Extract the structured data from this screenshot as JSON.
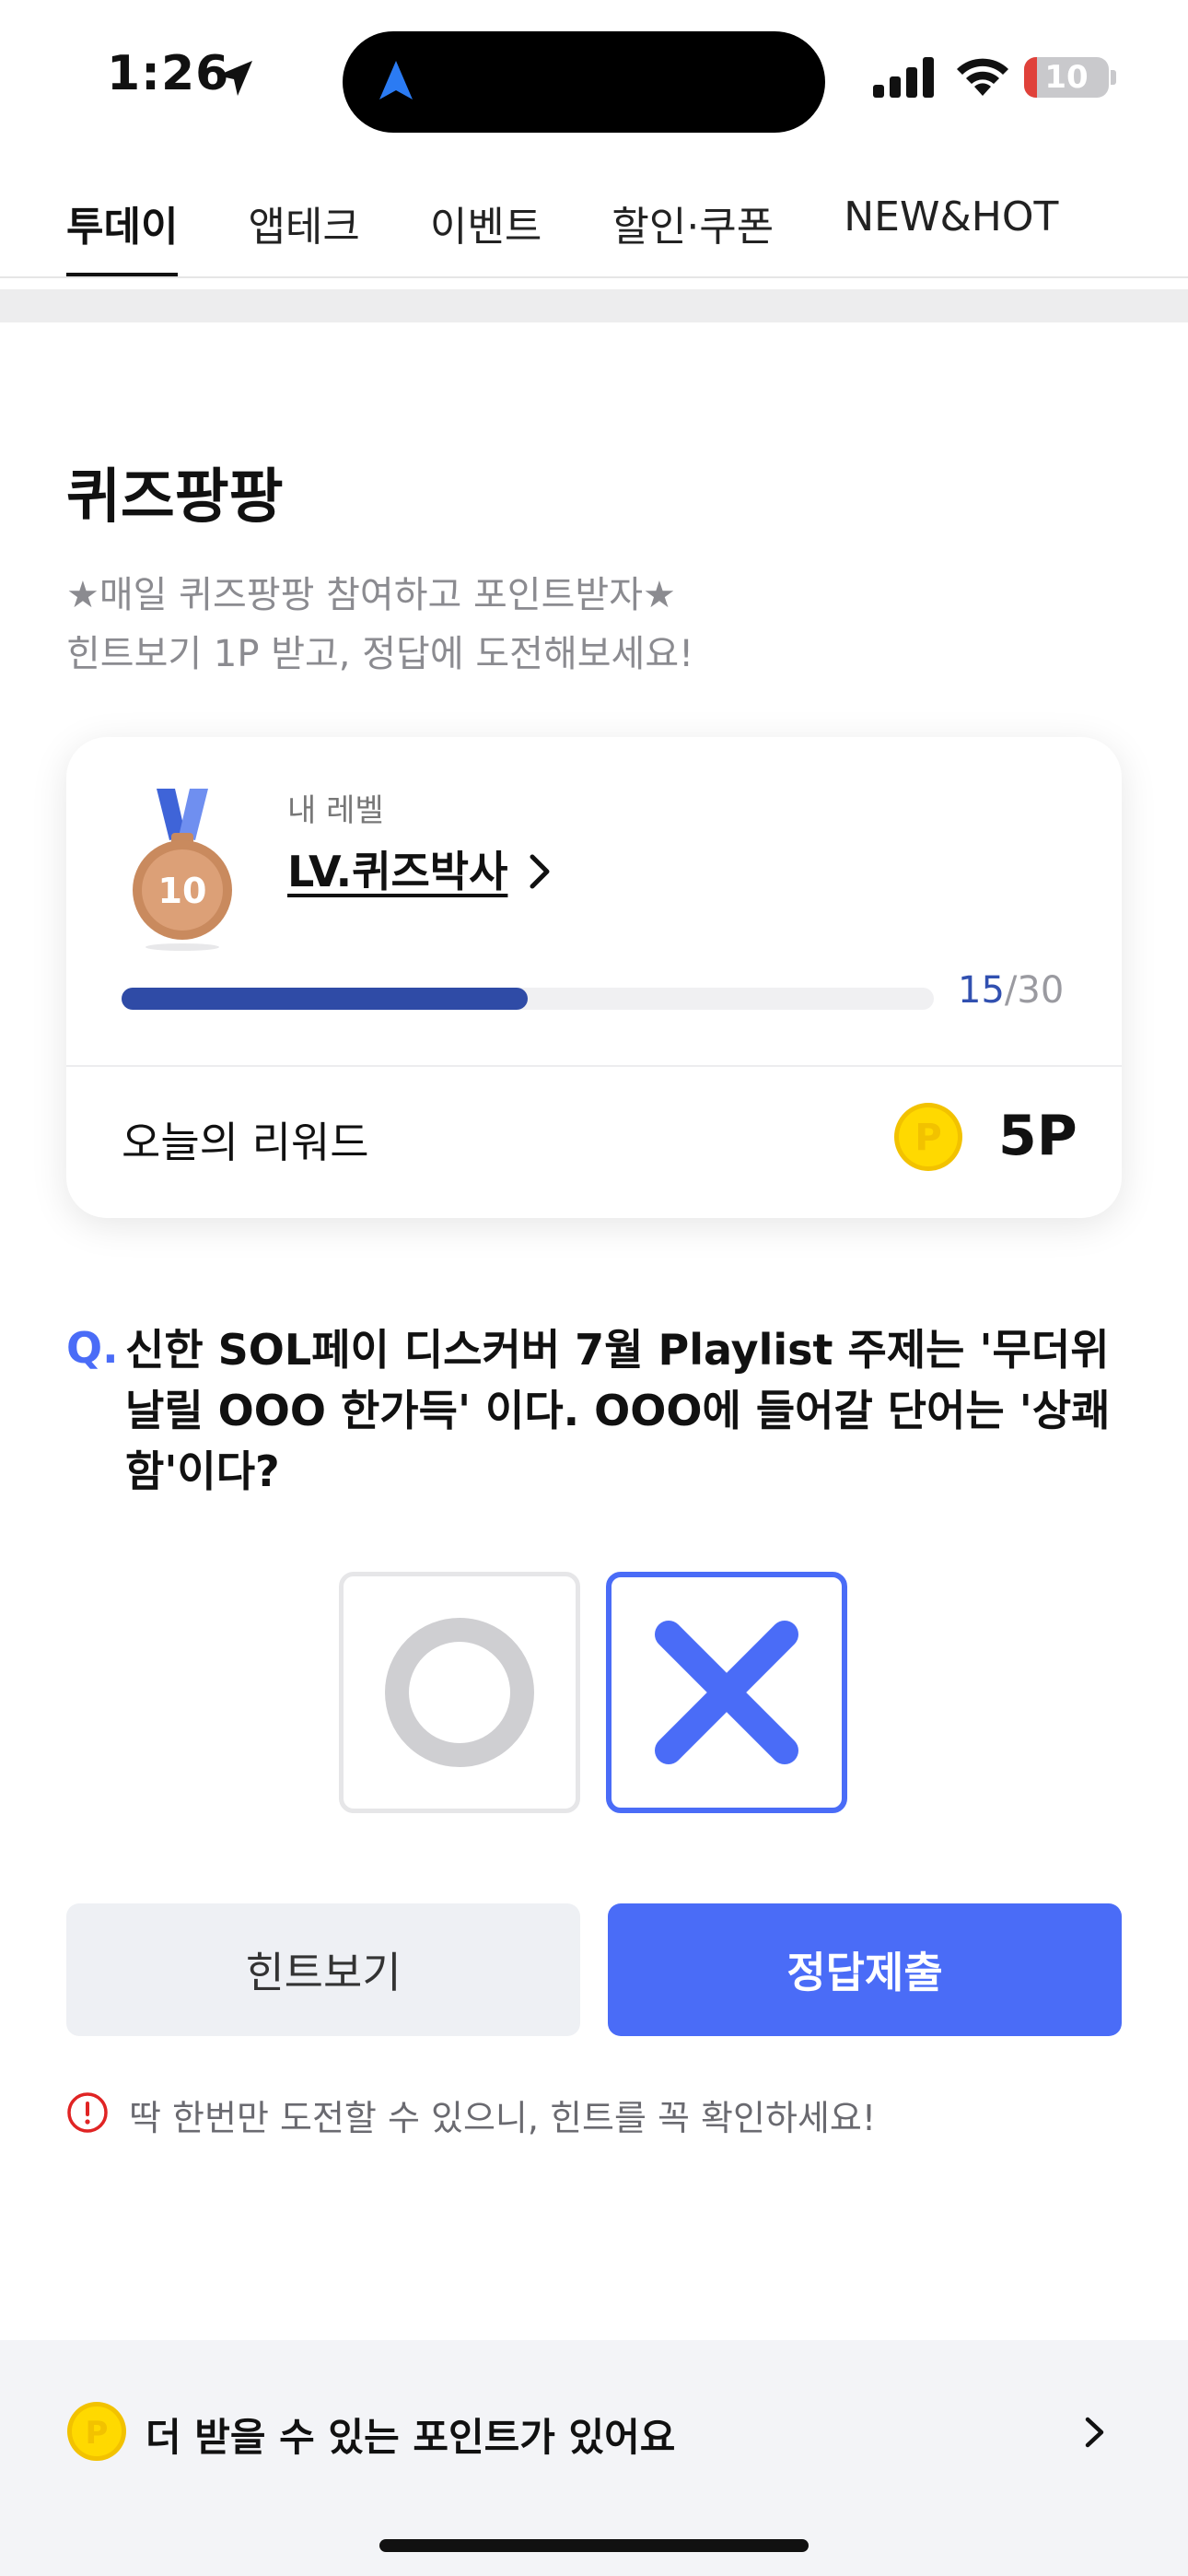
{
  "status_bar": {
    "time": "1:26",
    "battery_level": "10"
  },
  "tabs": [
    {
      "label": "투데이",
      "active": true
    },
    {
      "label": "앱테크",
      "active": false
    },
    {
      "label": "이벤트",
      "active": false
    },
    {
      "label": "할인·쿠폰",
      "active": false
    },
    {
      "label": "NEW&HOT",
      "active": false
    }
  ],
  "quiz": {
    "title": "퀴즈팡팡",
    "subtitle_line1": "★매일 퀴즈팡팡 참여하고 포인트받자★",
    "subtitle_line2": "힌트보기 1P 받고, 정답에 도전해보세요!"
  },
  "level_card": {
    "medal_number": "10",
    "level_label": "내 레벨",
    "level_name": "LV.퀴즈박사",
    "progress_current": "15",
    "progress_total": "/30",
    "progress_fraction": 0.5,
    "reward_label": "오늘의 리워드",
    "reward_value": "5P"
  },
  "question": {
    "prefix": "Q.",
    "text": "신한 SOL페이 디스커버 7월 Playlist 주제는 '무더위 날릴 OOO 한가득' 이다. OOO에 들어갈 단어는 '상쾌함'이다?",
    "selected_answer": "X"
  },
  "buttons": {
    "hint": "힌트보기",
    "submit": "정답제출"
  },
  "warning": "딱 한번만 도전할 수 있으니, 힌트를 꼭 확인하세요!",
  "bottom_banner": {
    "text": "더 받을 수 있는 포인트가 있어요"
  },
  "colors": {
    "accent": "#4a6cf7",
    "progress": "#2f4ba6",
    "coin": "#ffd400"
  }
}
